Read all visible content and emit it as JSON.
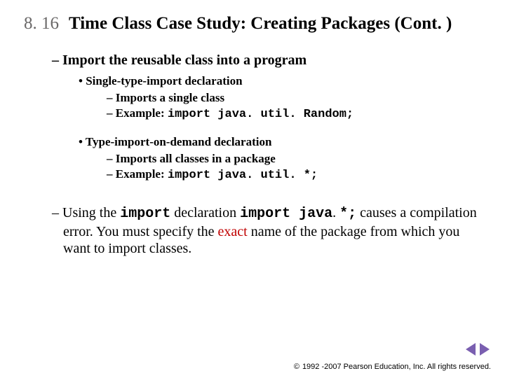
{
  "header": {
    "section_number": "8. 16",
    "title": "Time Class Case Study: Creating Packages (Cont. )"
  },
  "content": {
    "main1": "Import the reusable class into a program",
    "b1": "Single-type-import declaration",
    "b1s1": "Imports a single class",
    "b1s2_prefix": "Example: ",
    "b1s2_code": "import java. util. Random;",
    "b2": "Type-import-on-demand declaration",
    "b2s1": "Imports all classes in a package",
    "b2s2_prefix": "Example: ",
    "b2s2_code": "import java. util. *;",
    "using": {
      "t1": "Using the ",
      "c1": "import",
      "t2": " declaration ",
      "c2": "import java",
      "t2b": ". ",
      "c3": "*;",
      "t3": " causes a compilation error. You must specify the ",
      "exact": "exact",
      "t4": " name of the package from which you want to import classes."
    }
  },
  "footer": {
    "copyright_symbol": "©",
    "text": "1992 -2007 Pearson Education, Inc.  All rights reserved."
  },
  "nav": {
    "prev": "previous-slide",
    "next": "next-slide"
  }
}
